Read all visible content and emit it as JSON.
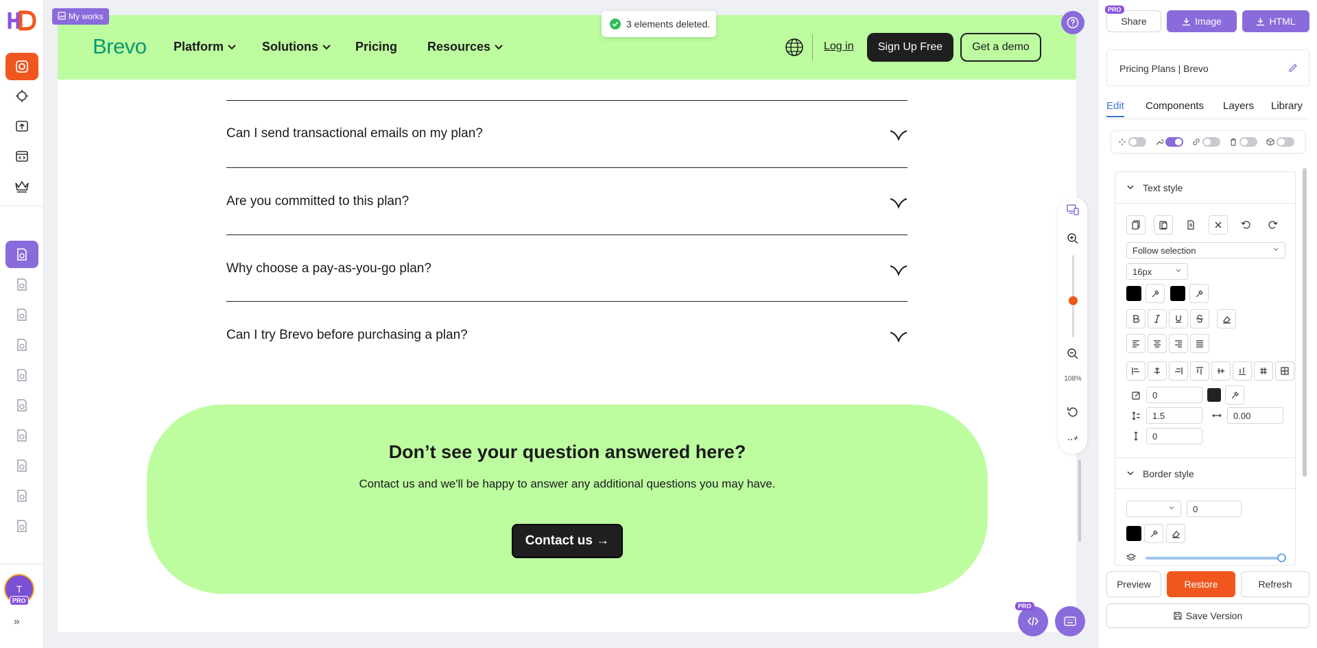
{
  "app": {
    "my_works_label": "My works",
    "toast": "3 elements deleted.",
    "avatar_initial": "T",
    "avatar_pro": "PRO",
    "zoom_level": "108%",
    "fab_pro": "PRO",
    "colors": {
      "accent": "#8a6bdb",
      "orange": "#f0571f",
      "site_green": "#bdfda0",
      "brand_green": "#0b996e"
    }
  },
  "site": {
    "brand": "Brevo",
    "nav": [
      {
        "label": "Platform",
        "has_dropdown": true
      },
      {
        "label": "Solutions",
        "has_dropdown": true
      },
      {
        "label": "Pricing",
        "has_dropdown": false
      },
      {
        "label": "Resources",
        "has_dropdown": true
      }
    ],
    "login": "Log in",
    "signup": "Sign Up Free",
    "demo": "Get a demo",
    "faq": [
      "Can I send transactional emails on my plan?",
      "Are you committed to this plan?",
      "Why choose a pay-as-you-go plan?",
      "Can I try Brevo before purchasing a plan?"
    ],
    "contact": {
      "title": "Don’t see your question answered here?",
      "subtitle": "Contact us and we'll be happy to answer any additional questions you may have.",
      "button": "Contact us →"
    }
  },
  "panel": {
    "pro_badge": "PRO",
    "share": "Share",
    "image": "Image",
    "html": "HTML",
    "page_title": "Pricing Plans | Brevo",
    "tabs": [
      "Edit",
      "Components",
      "Layers",
      "Library"
    ],
    "active_tab": "Edit",
    "toggles": [
      false,
      true,
      false,
      false,
      false
    ],
    "text_style": {
      "header": "Text style",
      "font_select": "Follow selection",
      "font_size": "16px",
      "border_width": "0",
      "line_height": "1.5",
      "letter_spacing": "0.00",
      "paragraph_spacing": "0"
    },
    "border_style": {
      "header": "Border style",
      "width": "0"
    },
    "preview": "Preview",
    "restore": "Restore",
    "refresh": "Refresh",
    "save_version": "Save Version"
  }
}
